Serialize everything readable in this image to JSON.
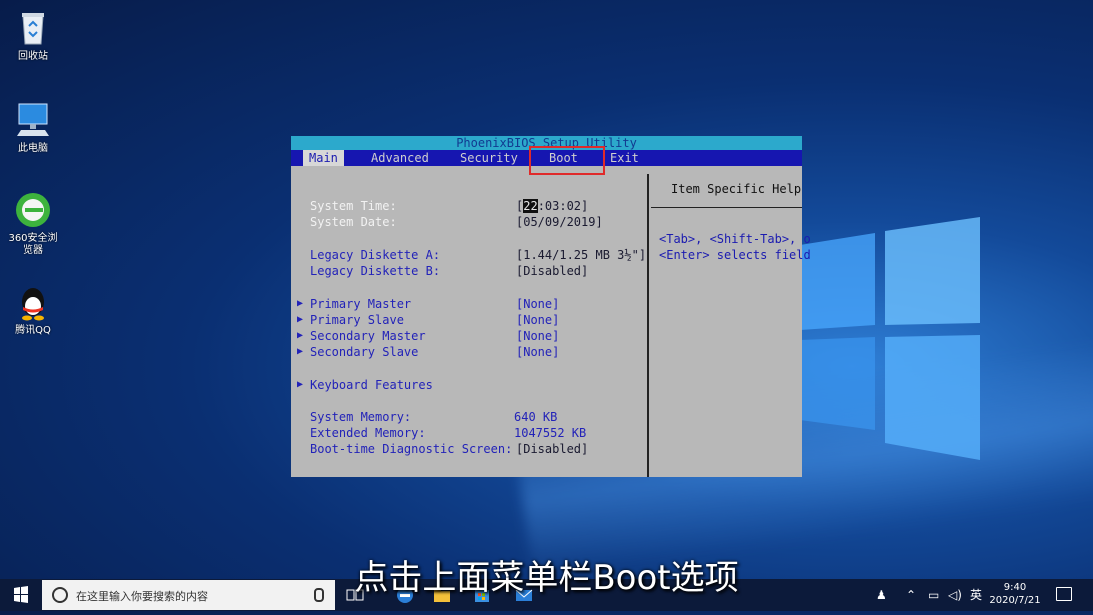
{
  "desktop": {
    "icons": [
      {
        "label": "回收站",
        "icon": "recycle-bin-icon"
      },
      {
        "label": "此电脑",
        "icon": "computer-icon"
      },
      {
        "label": "360安全浏览器",
        "icon": "browser-360-icon"
      },
      {
        "label": "腾讯QQ",
        "icon": "qq-icon"
      }
    ]
  },
  "bios": {
    "title": "PhoenixBIOS Setup Utility",
    "menu": [
      "Main",
      "Advanced",
      "Security",
      "Boot",
      "Exit"
    ],
    "active_menu": "Main",
    "highlight": "Boot",
    "rows": [
      {
        "label": "System Time:",
        "value_cursor": "22",
        "value_rest": ":03:02]",
        "value_prefix": "["
      },
      {
        "label": "System Date:",
        "value": "[05/09/2019]"
      },
      {
        "label": "Legacy Diskette A:",
        "value": "[1.44/1.25 MB  3½\"]"
      },
      {
        "label": "Legacy Diskette B:",
        "value": "[Disabled]"
      },
      {
        "label": "Primary Master",
        "value": "[None]"
      },
      {
        "label": "Primary Slave",
        "value": "[None]"
      },
      {
        "label": "Secondary Master",
        "value": "[None]"
      },
      {
        "label": "Secondary Slave",
        "value": "[None]"
      },
      {
        "label": "Keyboard Features",
        "value": ""
      },
      {
        "label": "System Memory:",
        "value": "640 KB"
      },
      {
        "label": "Extended Memory:",
        "value": "1047552 KB"
      },
      {
        "label": "Boot-time Diagnostic Screen:",
        "value": "[Disabled]"
      }
    ],
    "help": {
      "title": "Item Specific Help",
      "lines": [
        "<Tab>, <Shift-Tab>, o",
        "<Enter> selects field"
      ]
    }
  },
  "subtitle": "点击上面菜单栏Boot选项",
  "taskbar": {
    "search_placeholder": "在这里输入你要搜索的内容",
    "ime": "英",
    "time": "9:40",
    "date": "2020/7/21"
  },
  "colors": {
    "bios_bg": "#b8b8b8",
    "bios_menu_bar": "#1616b0",
    "bios_title_bar": "#2ca9cc",
    "highlight_box": "#e02a2a",
    "taskbar": "#0c1a3a"
  }
}
